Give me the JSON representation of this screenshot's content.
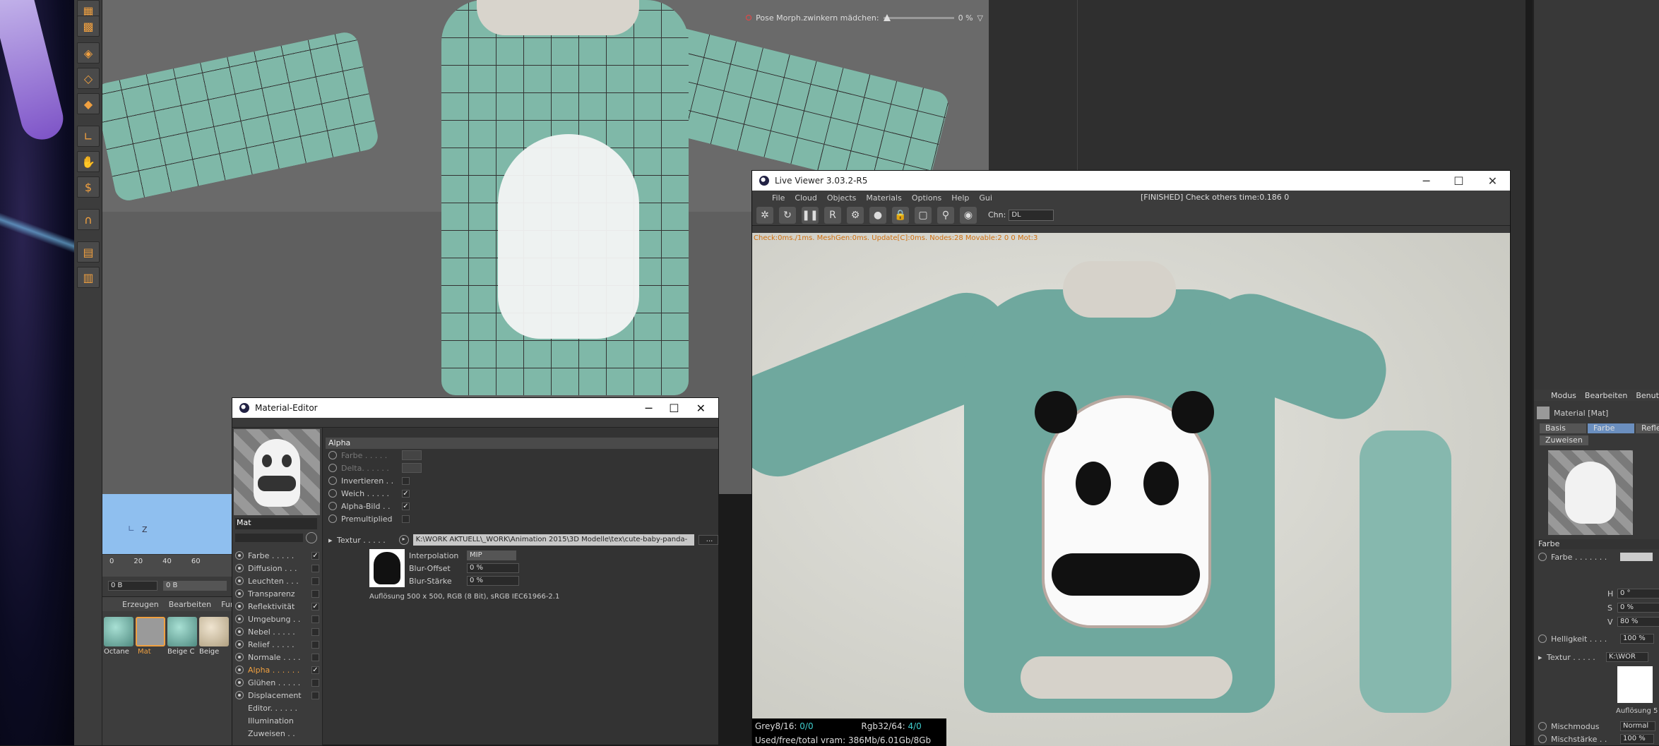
{
  "viewport": {
    "morph_label": "Pose Morph.zwinkern mädchen:",
    "morph_value": "0 %",
    "axis_label": "Z"
  },
  "timeline": {
    "ticks": [
      "0",
      "20",
      "40",
      "60"
    ],
    "frame_start": "0 B",
    "frame_end": "0 B"
  },
  "material_manager": {
    "menu": [
      "Erzeugen",
      "Bearbeiten",
      "Funk"
    ],
    "materials": [
      {
        "name": "Octane",
        "color": "#6fb3a7"
      },
      {
        "name": "Mat",
        "color": "#9a9a9a"
      },
      {
        "name": "Beige C",
        "color": "#6fb3a7"
      },
      {
        "name": "Beige",
        "color": "#c8b8a0"
      }
    ]
  },
  "material_editor": {
    "title": "Material-Editor",
    "material_name": "Mat",
    "channels": [
      {
        "label": "Farbe . . . . .",
        "checked": true
      },
      {
        "label": "Diffusion . . .",
        "checked": false
      },
      {
        "label": "Leuchten . . .",
        "checked": false
      },
      {
        "label": "Transparenz",
        "checked": false
      },
      {
        "label": "Reflektivität",
        "checked": true
      },
      {
        "label": "Umgebung . .",
        "checked": false
      },
      {
        "label": "Nebel . . . . .",
        "checked": false
      },
      {
        "label": "Relief . . . . .",
        "checked": false
      },
      {
        "label": "Normale . . . .",
        "checked": false
      },
      {
        "label": "Alpha . . . . . .",
        "checked": true
      },
      {
        "label": "Glühen . . . . .",
        "checked": false
      },
      {
        "label": "Displacement",
        "checked": false
      }
    ],
    "extra_items": [
      "Editor. . . . . .",
      "Illumination",
      "Zuweisen . ."
    ],
    "section_title": "Alpha",
    "props": {
      "farbe": "Farbe . . . . .",
      "delta": "Delta. . . . . .",
      "invertieren": "Invertieren . .",
      "weich": "Weich . . . . .",
      "alpha_bild": "Alpha-Bild . .",
      "premultiplied": "Premultiplied"
    },
    "texture_label": "Textur . . . . .",
    "texture_path": "K:\\WORK AKTUELL\\_WORK\\Animation 2015\\3D Modelle\\tex\\cute-baby-panda-",
    "texture_more": "...",
    "interpolation_label": "Interpolation",
    "interpolation_value": "MIP",
    "blur_offset_label": "Blur-Offset",
    "blur_offset_value": "0 %",
    "blur_staerke_label": "Blur-Stärke",
    "blur_staerke_value": "0 %",
    "resolution": "Auflösung 500 x 500, RGB (8 Bit), sRGB IEC61966-2.1"
  },
  "live_viewer": {
    "title": "Live Viewer 3.03.2-R5",
    "menu": [
      "File",
      "Cloud",
      "Objects",
      "Materials",
      "Options",
      "Help",
      "Gui"
    ],
    "status": "[FINISHED] Check others time:0.186  0",
    "chn_label": "Chn:",
    "chn_value": "DL",
    "info": "Check:0ms./1ms. MeshGen:0ms. Update[C]:0ms. Nodes:28 Movable:2  0 0 Mot:3",
    "grey_label": "Grey8/16:",
    "grey_value": "0/0",
    "rgb_label": "Rgb32/64:",
    "rgb_value": "4/0",
    "vram": "Used/free/total vram: 386Mb/6.01Gb/8Gb"
  },
  "right_panel": {
    "menu": [
      "Modus",
      "Bearbeiten",
      "Benut"
    ],
    "material_label": "Material [Mat]",
    "tabs": [
      "Basis",
      "Farbe",
      "Reflek"
    ],
    "assign": "Zuweisen",
    "section": "Farbe",
    "farbe_label": "Farbe . . . . . . .",
    "h_label": "H",
    "h_value": "0 °",
    "s_label": "S",
    "s_value": "0 %",
    "v_label": "V",
    "v_value": "80 %",
    "helligkeit_label": "Helligkeit . . . .",
    "helligkeit_value": "100 %",
    "textur_label": "Textur . . . . .",
    "textur_value": "K:\\WOR",
    "aufloesung": "Auflösung 5",
    "mischmodus_label": "Mischmodus",
    "mischmodus_value": "Normal",
    "mischstaerke_label": "Mischstärke . .",
    "mischstaerke_value": "100 %"
  }
}
